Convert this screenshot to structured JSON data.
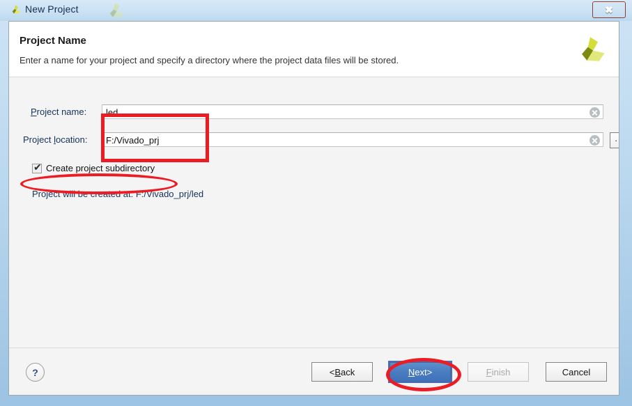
{
  "window": {
    "title": "New Project",
    "title_icon": "vivado-logo-icon",
    "close_label": "✖"
  },
  "header": {
    "title": "Project Name",
    "subtitle": "Enter a name for your project and specify a directory where the project data files will be stored.",
    "logo": "vivado-logo-icon"
  },
  "form": {
    "project_name": {
      "label_prefix": "P",
      "label_rest": "roject name:",
      "value": "led",
      "clear_icon": "clear-x-icon"
    },
    "project_location": {
      "label_prefix_plain": "Project ",
      "label_mnemonic": "l",
      "label_rest": "ocation:",
      "value": "F:/Vivado_prj",
      "clear_icon": "clear-x-icon"
    },
    "browse_label": "···",
    "checkbox": {
      "label": "Create project subdirectory",
      "checked": true,
      "tick": "✔"
    },
    "created_at": "Project will be created at: F:/Vivado_prj/led"
  },
  "footer": {
    "help_label": "?",
    "back": {
      "prefix": "< ",
      "mnemonic": "B",
      "rest": "ack"
    },
    "next": {
      "mnemonic": "N",
      "rest": "ext",
      "suffix": " >"
    },
    "finish": {
      "mnemonic": "F",
      "rest": "inish"
    },
    "cancel": {
      "text": "Cancel"
    }
  },
  "annotations": {
    "color": "#ec1c24",
    "items": [
      {
        "name": "rect-around-inputs",
        "shape": "rectangle"
      },
      {
        "name": "ellipse-around-checkbox",
        "shape": "ellipse"
      },
      {
        "name": "ellipse-around-next-button",
        "shape": "ellipse"
      }
    ]
  }
}
